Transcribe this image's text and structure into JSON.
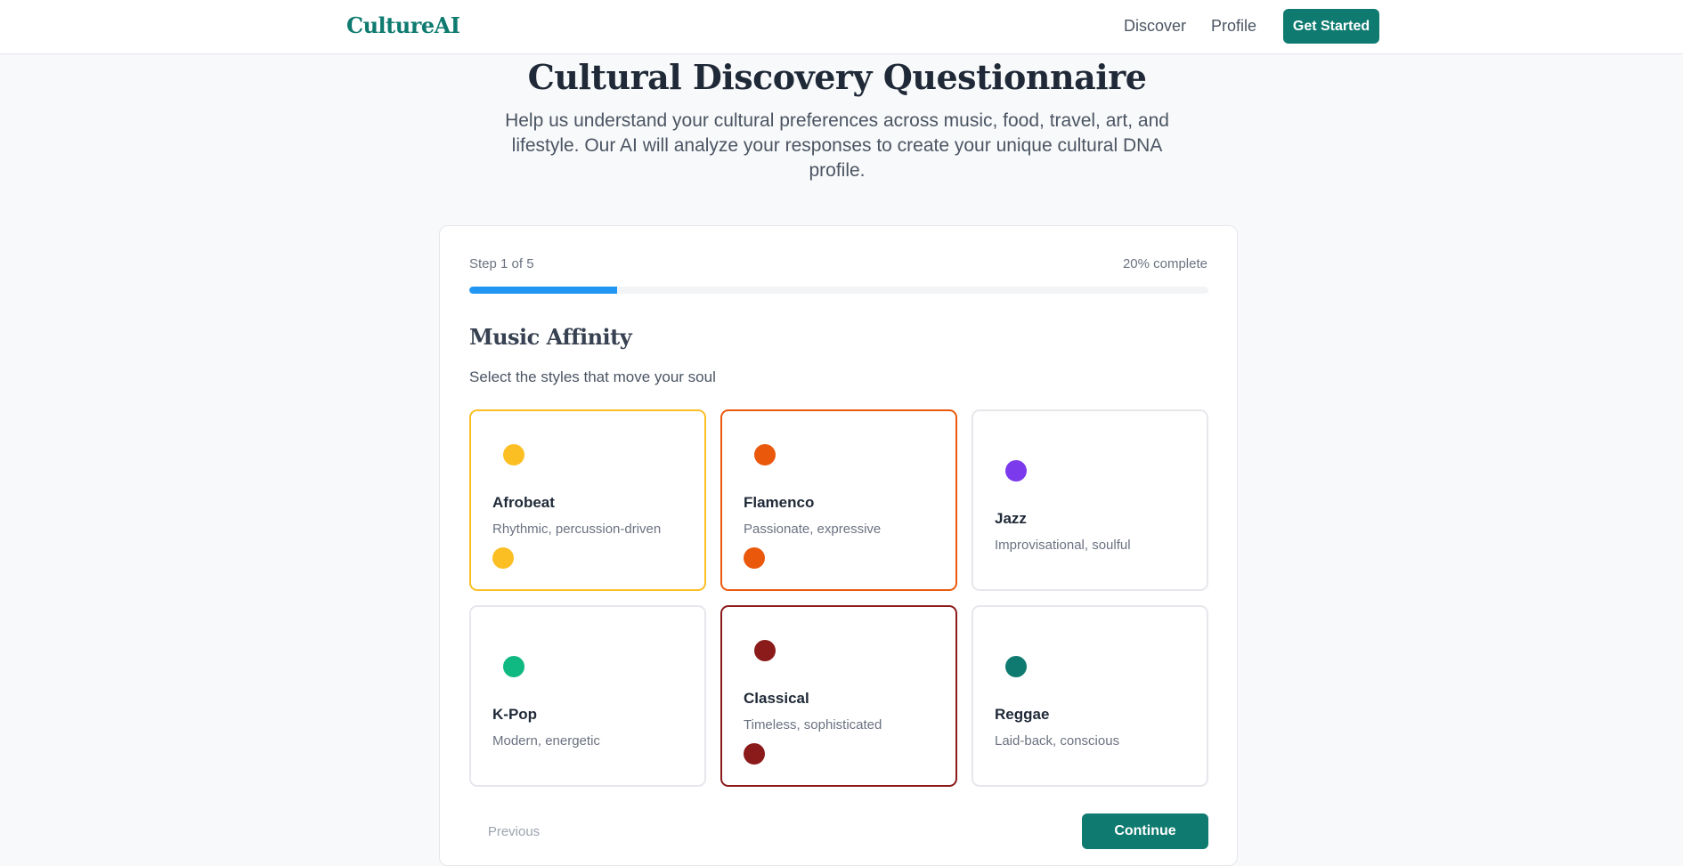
{
  "nav": {
    "logo": "CultureAI",
    "links": [
      "Discover",
      "Profile"
    ],
    "cta": "Get Started"
  },
  "header": {
    "title": "Cultural Discovery Questionnaire",
    "subtitle": "Help us understand your cultural preferences across music, food, travel, art, and lifestyle. Our AI will analyze your responses to create your unique cultural DNA profile."
  },
  "progress": {
    "step_label": "Step 1 of 5",
    "percent_label": "20% complete",
    "fraction": 0.2,
    "fill_color": "#2196f3"
  },
  "section": {
    "title": "Music Affinity",
    "subtitle": "Select the styles that move your soul"
  },
  "options": [
    {
      "name": "Afrobeat",
      "desc": "Rhythmic, percussion-driven",
      "color": "#fbbf24",
      "selected": true
    },
    {
      "name": "Flamenco",
      "desc": "Passionate, expressive",
      "color": "#ea580c",
      "selected": true
    },
    {
      "name": "Jazz",
      "desc": "Improvisational, soulful",
      "color": "#7c3aed",
      "selected": false
    },
    {
      "name": "K-Pop",
      "desc": "Modern, energetic",
      "color": "#10b981",
      "selected": false
    },
    {
      "name": "Classical",
      "desc": "Timeless, sophisticated",
      "color": "#8b1a1a",
      "selected": true
    },
    {
      "name": "Reggae",
      "desc": "Laid-back, conscious",
      "color": "#0f7b70",
      "selected": false
    }
  ],
  "actions": {
    "previous": "Previous",
    "continue": "Continue"
  },
  "colors": {
    "brand": "#0f7b70",
    "border_default": "#e5e7eb"
  }
}
